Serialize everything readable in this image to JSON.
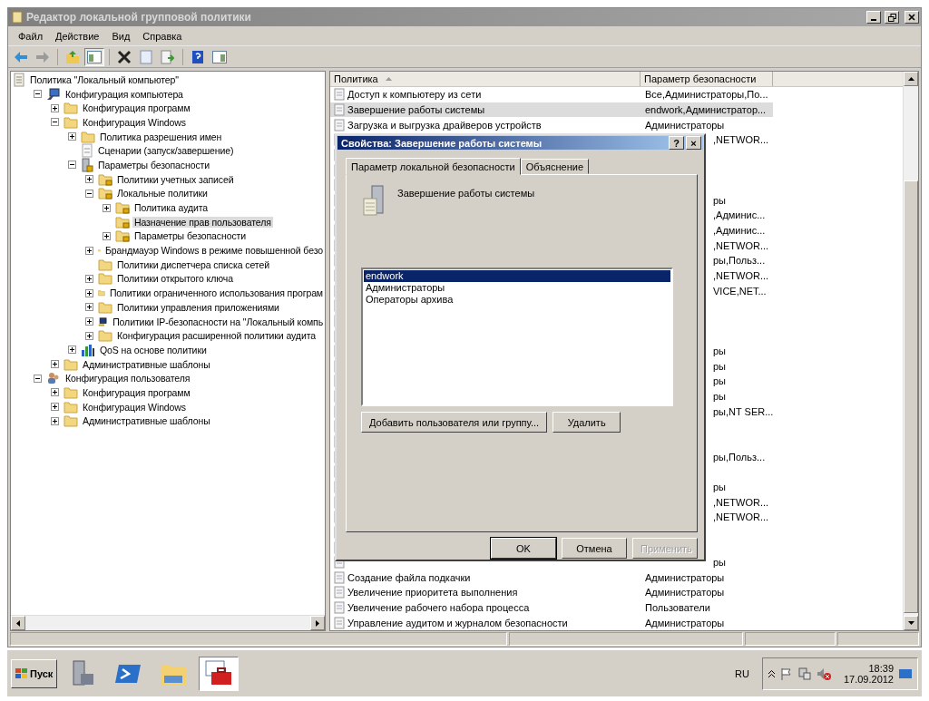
{
  "window": {
    "title": "Редактор локальной групповой политики"
  },
  "menu": [
    "Файл",
    "Действие",
    "Вид",
    "Справка"
  ],
  "toolbar": [
    {
      "kind": "back",
      "pressed": false
    },
    {
      "kind": "forward",
      "pressed": false
    },
    {
      "kind": "separator"
    },
    {
      "kind": "up",
      "pressed": false
    },
    {
      "kind": "tree",
      "pressed": true
    },
    {
      "kind": "separator"
    },
    {
      "kind": "delete",
      "pressed": false
    },
    {
      "kind": "properties",
      "pressed": false
    },
    {
      "kind": "export",
      "pressed": false
    },
    {
      "kind": "separator"
    },
    {
      "kind": "help",
      "pressed": false
    },
    {
      "kind": "pane",
      "pressed": false
    }
  ],
  "tree": [
    {
      "label": "Политика \"Локальный компьютер\"",
      "kind": "policy",
      "selected": false,
      "children": [
        {
          "label": "Конфигурация компьютера",
          "kind": "computer",
          "expanded": true,
          "selected": false,
          "children": [
            {
              "label": "Конфигурация программ",
              "kind": "folder",
              "expanded": false,
              "selected": false
            },
            {
              "label": "Конфигурация Windows",
              "kind": "folder",
              "expanded": true,
              "selected": false,
              "children": [
                {
                  "label": "Политика разрешения имен",
                  "kind": "folder",
                  "expanded": false,
                  "selected": false
                },
                {
                  "label": "Сценарии (запуск/завершение)",
                  "kind": "script",
                  "selected": false
                },
                {
                  "label": "Параметры безопасности",
                  "kind": "server",
                  "expanded": true,
                  "selected": false,
                  "children": [
                    {
                      "label": "Политики учетных записей",
                      "kind": "lock",
                      "expanded": false,
                      "selected": false
                    },
                    {
                      "label": "Локальные политики",
                      "kind": "lock",
                      "expanded": true,
                      "selected": false,
                      "children": [
                        {
                          "label": "Политика аудита",
                          "kind": "lock",
                          "expanded": false,
                          "selected": false
                        },
                        {
                          "label": "Назначение прав пользователя",
                          "kind": "lock",
                          "selected": true
                        },
                        {
                          "label": "Параметры безопасности",
                          "kind": "lock",
                          "expanded": false,
                          "selected": false
                        }
                      ]
                    },
                    {
                      "label": "Брандмауэр Windows в режиме повышенной безо",
                      "kind": "folder",
                      "expanded": false,
                      "selected": false
                    },
                    {
                      "label": "Политики диспетчера списка сетей",
                      "kind": "folder",
                      "selected": false
                    },
                    {
                      "label": "Политики открытого ключа",
                      "kind": "folder",
                      "expanded": false,
                      "selected": false
                    },
                    {
                      "label": "Политики ограниченного использования програм",
                      "kind": "folder",
                      "expanded": false,
                      "selected": false
                    },
                    {
                      "label": "Политики управления приложениями",
                      "kind": "folder",
                      "expanded": false,
                      "selected": false
                    },
                    {
                      "label": "Политики IP-безопасности на \"Локальный компь",
                      "kind": "ipsec",
                      "expanded": false,
                      "selected": false
                    },
                    {
                      "label": "Конфигурация расширенной политики аудита",
                      "kind": "folder",
                      "expanded": false,
                      "selected": false
                    }
                  ]
                },
                {
                  "label": "QoS на основе политики",
                  "kind": "qos",
                  "expanded": false,
                  "selected": false
                }
              ]
            },
            {
              "label": "Административные шаблоны",
              "kind": "folder",
              "expanded": false,
              "selected": false
            }
          ]
        },
        {
          "label": "Конфигурация пользователя",
          "kind": "user",
          "expanded": true,
          "selected": false,
          "children": [
            {
              "label": "Конфигурация программ",
              "kind": "folder",
              "expanded": false,
              "selected": false
            },
            {
              "label": "Конфигурация Windows",
              "kind": "folder",
              "expanded": false,
              "selected": false
            },
            {
              "label": "Административные шаблоны",
              "kind": "folder",
              "expanded": false,
              "selected": false
            }
          ]
        }
      ]
    }
  ],
  "list": {
    "columns": [
      "Политика",
      "Параметр безопасности"
    ],
    "rows": [
      {
        "kind": "full",
        "policy": "Доступ к компьютеру из сети",
        "setting": "Все,Администраторы,По...",
        "selected": false
      },
      {
        "kind": "full",
        "policy": "Завершение работы системы",
        "setting": "endwork,Администратор...",
        "selected": true
      },
      {
        "kind": "full",
        "policy": "Загрузка и выгрузка драйверов устройств",
        "setting": "Администраторы",
        "selected": false
      },
      {
        "kind": "covered",
        "setting": ",NETWOR..."
      },
      {
        "kind": "covered"
      },
      {
        "kind": "covered"
      },
      {
        "kind": "covered"
      },
      {
        "kind": "covered",
        "setting": "ры"
      },
      {
        "kind": "covered",
        "setting": ",Админис..."
      },
      {
        "kind": "covered",
        "setting": ",Админис..."
      },
      {
        "kind": "covered",
        "setting": ",NETWOR..."
      },
      {
        "kind": "covered",
        "setting": "ры,Польз..."
      },
      {
        "kind": "covered",
        "setting": ",NETWOR..."
      },
      {
        "kind": "covered",
        "setting": "VICE,NET..."
      },
      {
        "kind": "covered"
      },
      {
        "kind": "covered"
      },
      {
        "kind": "covered"
      },
      {
        "kind": "covered",
        "setting": "ры"
      },
      {
        "kind": "covered",
        "setting": "ры"
      },
      {
        "kind": "covered",
        "setting": "ры"
      },
      {
        "kind": "covered",
        "setting": "ры"
      },
      {
        "kind": "covered",
        "setting": "ры,NT SER..."
      },
      {
        "kind": "covered"
      },
      {
        "kind": "covered"
      },
      {
        "kind": "covered",
        "setting": "ры,Польз..."
      },
      {
        "kind": "covered"
      },
      {
        "kind": "covered",
        "setting": "ры"
      },
      {
        "kind": "covered",
        "setting": ",NETWOR..."
      },
      {
        "kind": "covered",
        "setting": ",NETWOR..."
      },
      {
        "kind": "covered"
      },
      {
        "kind": "covered"
      },
      {
        "kind": "covered",
        "setting": "ры"
      },
      {
        "kind": "full",
        "policy": "Создание файла подкачки",
        "setting": "Администраторы",
        "selected": false
      },
      {
        "kind": "full",
        "policy": "Увеличение приоритета выполнения",
        "setting": "Администраторы",
        "selected": false
      },
      {
        "kind": "full",
        "policy": "Увеличение рабочего набора процесса",
        "setting": "Пользователи",
        "selected": false
      },
      {
        "kind": "full",
        "policy": "Управление аудитом и журналом безопасности",
        "setting": "Администраторы",
        "selected": false
      }
    ]
  },
  "dialog": {
    "title": "Свойства: Завершение работы системы",
    "help": "?",
    "close": "×",
    "tabs": [
      {
        "label": "Параметр локальной безопасности",
        "selected": true
      },
      {
        "label": "Объяснение",
        "selected": false
      }
    ],
    "heading": "Завершение работы системы",
    "accounts": [
      {
        "name": "endwork",
        "selected": true
      },
      {
        "name": "Администраторы",
        "selected": false
      },
      {
        "name": "Операторы архива",
        "selected": false
      }
    ],
    "add_button": "Добавить пользователя или группу...",
    "remove_button": "Удалить",
    "buttons": [
      {
        "label": "OK",
        "default": true,
        "disabled": false
      },
      {
        "label": "Отмена",
        "default": false,
        "disabled": false
      },
      {
        "label": "Применить",
        "default": false,
        "disabled": true
      }
    ]
  },
  "taskbar": {
    "start": "Пуск",
    "apps": [
      {
        "kind": "server",
        "selected": false
      },
      {
        "kind": "powershell",
        "selected": false
      },
      {
        "kind": "explorer",
        "selected": false
      },
      {
        "kind": "toolbox",
        "selected": true
      }
    ],
    "language": "RU",
    "time": "18:39",
    "date": "17.09.2012"
  }
}
